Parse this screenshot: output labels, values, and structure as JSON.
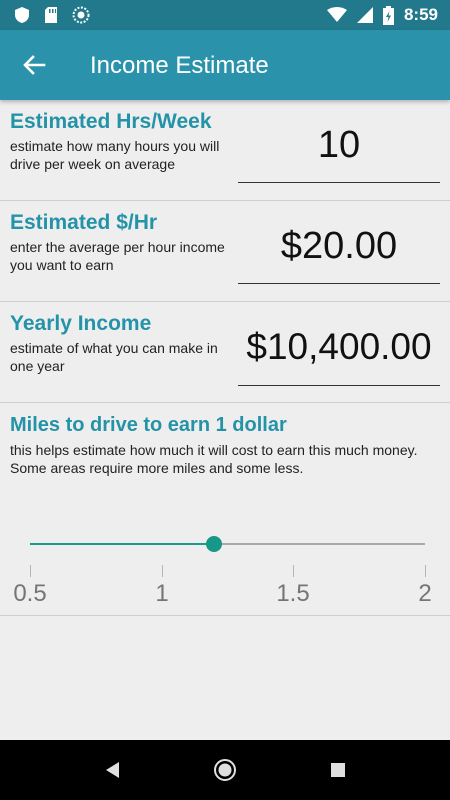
{
  "status_bar": {
    "time": "8:59",
    "icons": [
      "shield-icon",
      "sd-card-icon",
      "sync-icon",
      "wifi-icon",
      "cell-signal-icon",
      "battery-charging-icon"
    ]
  },
  "app_bar": {
    "title": "Income Estimate",
    "back_icon": "arrow-back-icon"
  },
  "hours": {
    "title": "Estimated Hrs/Week",
    "description": "estimate how many hours you will drive per week on average",
    "value": "10"
  },
  "rate": {
    "title": "Estimated $/Hr",
    "description": "enter the average per hour income you want to earn",
    "value": "$20.00"
  },
  "yearly": {
    "title": "Yearly Income",
    "description": "estimate of what you can make in one year",
    "value": "$10,400.00"
  },
  "miles": {
    "title": "Miles to drive to earn 1 dollar",
    "description": "this helps estimate how much it will cost to earn this much money. Some areas require more miles and some less.",
    "slider": {
      "min": 0.5,
      "max": 2,
      "value": 1.2,
      "tick_labels": [
        "0.5",
        "1",
        "1.5",
        "2"
      ],
      "accent": "#16978a"
    }
  },
  "colors": {
    "primary": "#2a93ab",
    "primary_dark": "#23798c",
    "accent": "#16978a",
    "title_text": "#2493a8"
  },
  "nav_bar": {
    "buttons": [
      "back-triangle-icon",
      "home-circle-icon",
      "recents-square-icon"
    ]
  }
}
